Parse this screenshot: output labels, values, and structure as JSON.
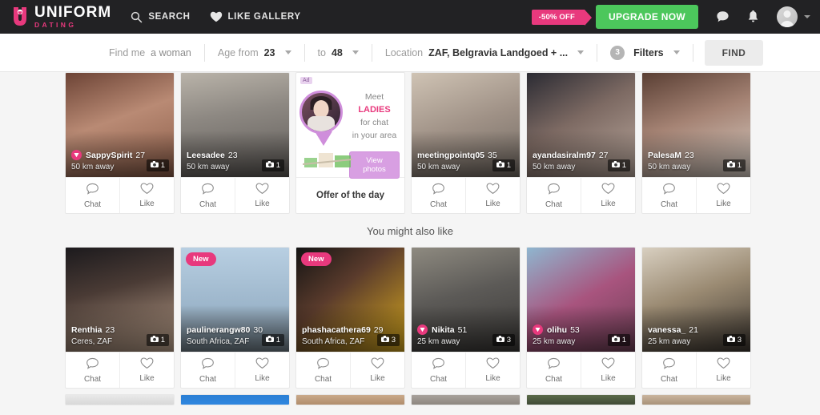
{
  "header": {
    "logo_top": "UNIFORM",
    "logo_sub": "DATING",
    "nav": [
      {
        "label": "SEARCH",
        "icon": "search-icon"
      },
      {
        "label": "LIKE GALLERY",
        "icon": "heart-icon"
      }
    ],
    "promo_label": "-50% OFF",
    "upgrade_label": "UPGRADE NOW",
    "icons": [
      "messages-icon",
      "notifications-icon",
      "avatar"
    ],
    "colors": {
      "accent_pink": "#e8397d",
      "upgrade_green": "#4cc75c",
      "bar_dark": "#222224"
    }
  },
  "searchbar": {
    "find_me_label": "Find me",
    "find_me_value": "a woman",
    "age_from_label": "Age from",
    "age_from_value": "23",
    "age_to_label": "to",
    "age_to_value": "48",
    "location_label": "Location",
    "location_value": "ZAF, Belgravia Landgoed + ...",
    "filters_count": "3",
    "filters_label": "Filters",
    "find_button": "FIND"
  },
  "section_title": "You might also like",
  "card_actions": {
    "chat": "Chat",
    "like": "Like"
  },
  "ad": {
    "label": "Ad",
    "line1": "Meet",
    "line2": "LADIES",
    "line3": "for chat",
    "line4": "in your area",
    "cta": "View photos",
    "footer": "Offer of the day"
  },
  "row1": [
    {
      "name": "SappySpirit",
      "age": "27",
      "location": "50 km away",
      "photos": "1",
      "vip": true,
      "new": false,
      "photo_bg": "linear-gradient(160deg,#6d4436 0%,#b98a74 45%,#8a5c48 100%)"
    },
    {
      "name": "Leesadee",
      "age": "23",
      "location": "50 km away",
      "photos": "1",
      "vip": false,
      "new": false,
      "photo_bg": "linear-gradient(170deg,#b9b3a9 0%,#8d8882 40%,#5e5a57 100%)"
    },
    {
      "name": "meetingpointq05",
      "age": "35",
      "location": "50 km away",
      "photos": "1",
      "vip": false,
      "new": false,
      "photo_bg": "linear-gradient(160deg,#cfc3b4 0%,#9f9186 50%,#726a63 100%)"
    },
    {
      "name": "ayandasiralm97",
      "age": "27",
      "location": "50 km away",
      "photos": "1",
      "vip": false,
      "new": false,
      "photo_bg": "linear-gradient(150deg,#2b2b33 0%,#7d6a63 45%,#b9a79c 100%)"
    },
    {
      "name": "PalesaM",
      "age": "23",
      "location": "50 km away",
      "photos": "1",
      "vip": false,
      "new": false,
      "photo_bg": "linear-gradient(160deg,#5a3f34 0%,#a58374 45%,#d8cfc6 100%)"
    }
  ],
  "row2": [
    {
      "name": "Renthia",
      "age": "23",
      "location": "Ceres, ZAF",
      "photos": "1",
      "vip": false,
      "new": false,
      "photo_bg": "linear-gradient(165deg,#1c1a1d 0%,#4a3b35 40%,#c0a58f 100%)"
    },
    {
      "name": "paulinerangw80",
      "age": "30",
      "location": "South Africa, ZAF",
      "photos": "1",
      "vip": false,
      "new": true,
      "photo_bg": "linear-gradient(180deg,#b8cfe2 0%,#9db6cb 55%,#6f7d86 100%)"
    },
    {
      "name": "phashacathera69",
      "age": "29",
      "location": "South Africa, ZAF",
      "photos": "3",
      "vip": false,
      "new": true,
      "photo_bg": "linear-gradient(140deg,#141414 0%,#5a3b2c 40%,#d6a81e 100%)"
    },
    {
      "name": "Nikita",
      "age": "51",
      "location": "25 km away",
      "photos": "3",
      "vip": true,
      "new": false,
      "photo_bg": "linear-gradient(165deg,#8e8a80 0%,#5c5a57 45%,#3a3836 100%)"
    },
    {
      "name": "olihu",
      "age": "53",
      "location": "25 km away",
      "photos": "1",
      "vip": true,
      "new": false,
      "photo_bg": "linear-gradient(150deg,#8fb6cf 0%,#a8547e 50%,#6d3f55 100%)"
    },
    {
      "name": "vanessa_",
      "age": "21",
      "location": "25 km away",
      "photos": "3",
      "vip": false,
      "new": false,
      "photo_bg": "linear-gradient(160deg,#d8cfc0 0%,#9a8a72 45%,#3c3630 100%)"
    }
  ],
  "row3_peek": [
    {
      "photo_bg": "linear-gradient(180deg,#e9e9e9,#d8d8d8)"
    },
    {
      "photo_bg": "linear-gradient(180deg,#2b7fd4,#2f86df)"
    },
    {
      "photo_bg": "linear-gradient(180deg,#caa98a,#b08d6c)"
    },
    {
      "photo_bg": "linear-gradient(180deg,#a8a29c,#8d867f)"
    },
    {
      "photo_bg": "linear-gradient(180deg,#5c6b4a,#3f4a36)"
    },
    {
      "photo_bg": "linear-gradient(180deg,#c9b49e,#a89279)"
    }
  ]
}
